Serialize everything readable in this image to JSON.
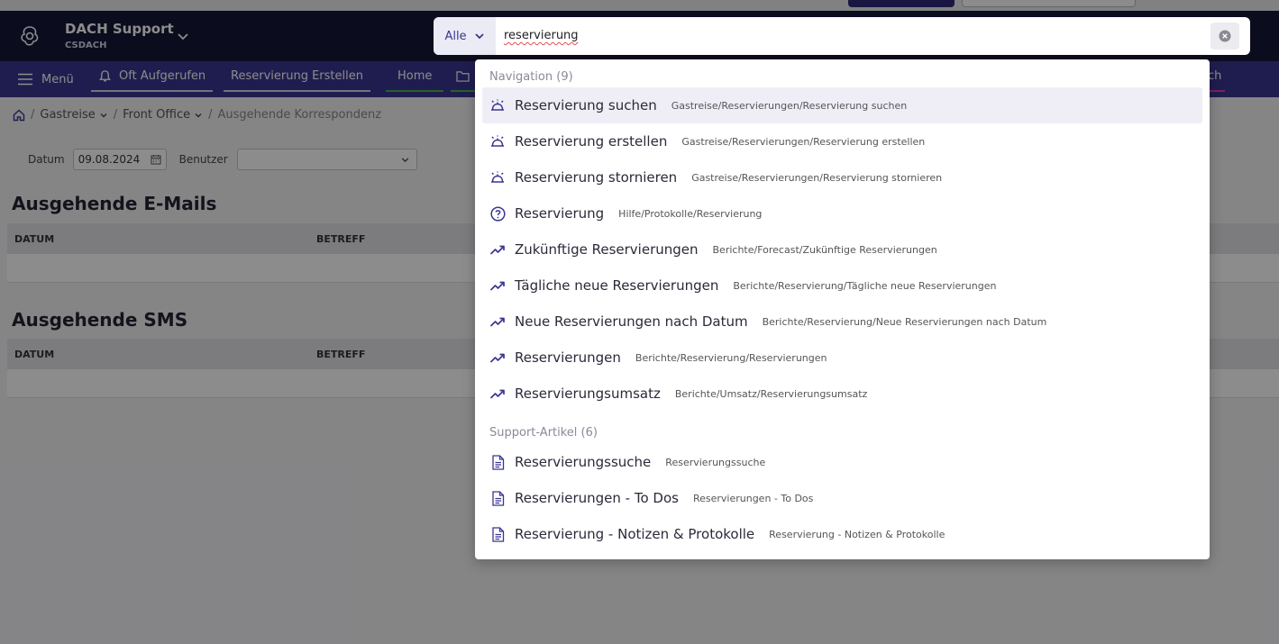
{
  "header": {
    "org_title": "DACH Support",
    "org_subtitle": "CSDACH"
  },
  "navbar": {
    "menu_label": "Menü",
    "oft_label": "Oft Aufgerufen",
    "reservation_label": "Reservierung Erstellen",
    "home_label": "Home",
    "right_tab_fragment": "ch"
  },
  "breadcrumb": {
    "items": [
      "Gastreise",
      "Front Office"
    ],
    "current": "Ausgehende Korrespondenz"
  },
  "filters": {
    "date_label": "Datum",
    "date_value": "09.08.2024",
    "user_label": "Benutzer",
    "user_value": ""
  },
  "emails": {
    "title": "Ausgehende E-Mails",
    "columns": [
      "DATUM",
      "BETREFF"
    ]
  },
  "sms": {
    "title": "Ausgehende SMS",
    "columns": [
      "DATUM",
      "BETREFF"
    ]
  },
  "search": {
    "scope": "Alle",
    "query": "reservierung"
  },
  "results": {
    "navigation_title": "Navigation (9)",
    "navigation": [
      {
        "label": "Reservierung suchen",
        "path": "Gastreise/Reservierungen/Reservierung suchen",
        "icon": "room-service-icon"
      },
      {
        "label": "Reservierung erstellen",
        "path": "Gastreise/Reservierungen/Reservierung erstellen",
        "icon": "room-service-icon"
      },
      {
        "label": "Reservierung stornieren",
        "path": "Gastreise/Reservierungen/Reservierung stornieren",
        "icon": "room-service-icon"
      },
      {
        "label": "Reservierung",
        "path": "Hilfe/Protokolle/Reservierung",
        "icon": "help-circle-icon"
      },
      {
        "label": "Zukünftige Reservierungen",
        "path": "Berichte/Forecast/Zukünftige Reservierungen",
        "icon": "trending-up-icon"
      },
      {
        "label": "Tägliche neue Reservierungen",
        "path": "Berichte/Reservierung/Tägliche neue Reservierungen",
        "icon": "trending-up-icon"
      },
      {
        "label": "Neue Reservierungen nach Datum",
        "path": "Berichte/Reservierung/Neue Reservierungen nach Datum",
        "icon": "trending-up-icon"
      },
      {
        "label": "Reservierungen",
        "path": "Berichte/Reservierung/Reservierungen",
        "icon": "trending-up-icon"
      },
      {
        "label": "Reservierungsumsatz",
        "path": "Berichte/Umsatz/Reservierungsumsatz",
        "icon": "trending-up-icon"
      }
    ],
    "support_title": "Support-Artikel (6)",
    "support": [
      {
        "label": "Reservierungssuche",
        "path": "Reservierungssuche",
        "icon": "document-icon"
      },
      {
        "label": "Reservierungen - To Dos",
        "path": "Reservierungen - To Dos",
        "icon": "document-icon"
      },
      {
        "label": "Reservierung - Notizen & Protokolle",
        "path": "Reservierung - Notizen & Protokolle",
        "icon": "document-icon"
      }
    ]
  },
  "colors": {
    "header_bg": "#17163a",
    "navbar_bg": "#3a3690",
    "accent": "#3a3690"
  }
}
